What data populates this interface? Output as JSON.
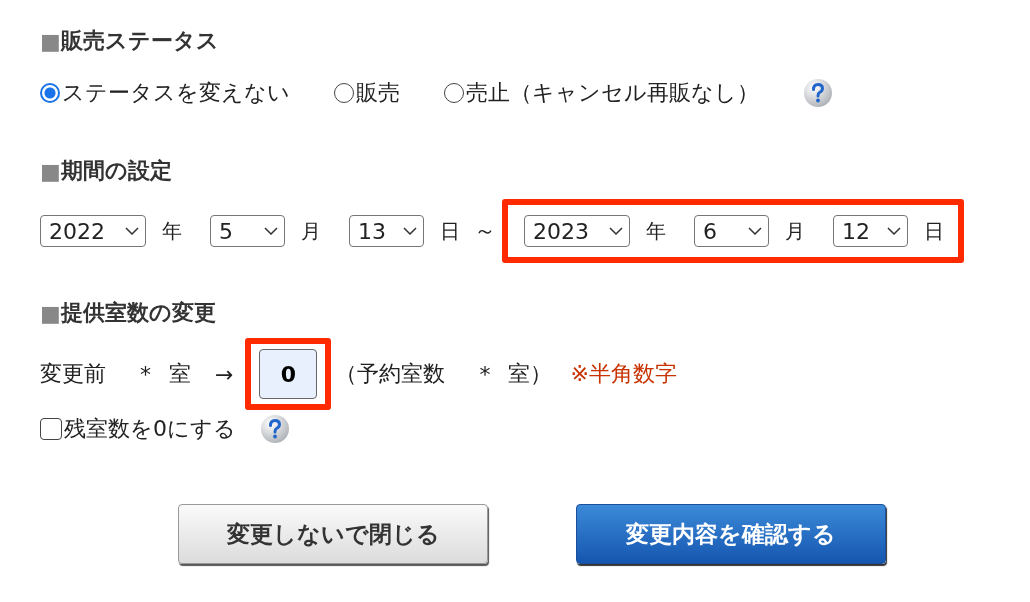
{
  "status": {
    "heading": {
      "marker": "■",
      "text": "販売ステータス"
    },
    "options": [
      {
        "label": "ステータスを変えない",
        "selected": true
      },
      {
        "label": "販売",
        "selected": false
      },
      {
        "label": "売止（キャンセル再販なし）",
        "selected": false
      }
    ]
  },
  "period": {
    "heading": {
      "marker": "■",
      "text": "期間の設定"
    },
    "start": [
      {
        "value": "2022",
        "unit": "年"
      },
      {
        "value": "5",
        "unit": "月"
      },
      {
        "value": "13",
        "unit": "日"
      }
    ],
    "separator": "～",
    "end_highlighted": true,
    "end": [
      {
        "value": "2023",
        "unit": "年"
      },
      {
        "value": "6",
        "unit": "月"
      },
      {
        "value": "12",
        "unit": "日"
      }
    ]
  },
  "rooms": {
    "heading": {
      "marker": "■",
      "text": "提供室数の変更"
    },
    "before_label": "変更前",
    "before_value": "*",
    "before_unit": "室",
    "arrow": "→",
    "input": {
      "value": "0",
      "highlighted": true
    },
    "reserved_open": "（予約室数",
    "reserved_value": "*",
    "reserved_close": "室）",
    "note": "※半角数字",
    "zero_checkbox": {
      "label": "残室数を0にする",
      "checked": false
    }
  },
  "buttons": [
    {
      "label": "変更しないで閉じる",
      "kind": "secondary"
    },
    {
      "label": "変更内容を確認する",
      "kind": "primary"
    }
  ]
}
